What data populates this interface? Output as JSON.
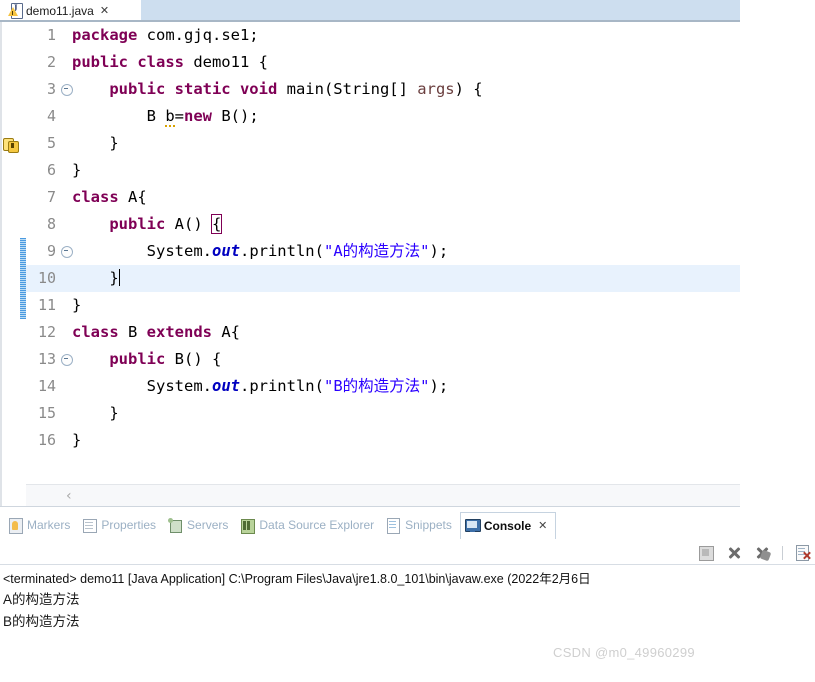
{
  "editor": {
    "tab": {
      "filename": "demo11.java",
      "close_glyph": "✕",
      "icon": "java-file-warning-icon"
    },
    "lines": [
      {
        "num": "1",
        "folding": false,
        "marker": null,
        "current": false,
        "changed": false
      },
      {
        "num": "2",
        "folding": false,
        "marker": null,
        "current": false,
        "changed": false
      },
      {
        "num": "3",
        "folding": true,
        "marker": null,
        "current": false,
        "changed": false
      },
      {
        "num": "4",
        "folding": false,
        "marker": "warning",
        "current": false,
        "changed": false
      },
      {
        "num": "5",
        "folding": false,
        "marker": null,
        "current": false,
        "changed": false
      },
      {
        "num": "6",
        "folding": false,
        "marker": null,
        "current": false,
        "changed": false
      },
      {
        "num": "7",
        "folding": false,
        "marker": null,
        "current": false,
        "changed": false
      },
      {
        "num": "8",
        "folding": true,
        "marker": null,
        "current": false,
        "changed": true
      },
      {
        "num": "9",
        "folding": false,
        "marker": null,
        "current": false,
        "changed": true
      },
      {
        "num": "10",
        "folding": false,
        "marker": null,
        "current": true,
        "changed": true
      },
      {
        "num": "11",
        "folding": false,
        "marker": null,
        "current": false,
        "changed": false
      },
      {
        "num": "12",
        "folding": false,
        "marker": null,
        "current": false,
        "changed": false
      },
      {
        "num": "13",
        "folding": true,
        "marker": null,
        "current": false,
        "changed": false
      },
      {
        "num": "14",
        "folding": false,
        "marker": null,
        "current": false,
        "changed": false
      },
      {
        "num": "15",
        "folding": false,
        "marker": null,
        "current": false,
        "changed": false
      },
      {
        "num": "16",
        "folding": false,
        "marker": null,
        "current": false,
        "changed": false
      }
    ],
    "code_text": [
      "package com.gjq.se1;",
      "public class demo11 {",
      "    public static void main(String[] args) {",
      "        B b=new B();",
      "    }",
      "}",
      "class A{",
      "    public A() {",
      "        System.out.println(\"A的构造方法\");",
      "    }",
      "}",
      "class B extends A{",
      "    public B() {",
      "        System.out.println(\"B的构造方法\");",
      "    }",
      "}"
    ],
    "scroll_left_arrow": "‹",
    "colors": {
      "keyword": "#7f0055",
      "string": "#2a00ff",
      "field": "#0000c0",
      "parameter": "#6a3e3e",
      "line_number": "#8a8a8a",
      "current_line_highlight": "#e8f2fd",
      "changed_bar": "#6cb1e8"
    }
  },
  "bottom_view": {
    "tabs": [
      {
        "label": "Markers",
        "icon": "markers-icon",
        "active": false
      },
      {
        "label": "Properties",
        "icon": "properties-icon",
        "active": false
      },
      {
        "label": "Servers",
        "icon": "servers-icon",
        "active": false
      },
      {
        "label": "Data Source Explorer",
        "icon": "data-source-explorer-icon",
        "active": false
      },
      {
        "label": "Snippets",
        "icon": "snippets-icon",
        "active": false
      },
      {
        "label": "Console",
        "icon": "console-icon",
        "active": true
      }
    ],
    "active_tab_close_glyph": "✕",
    "toolbar": [
      {
        "name": "terminate-button",
        "icon": "stop-square-icon"
      },
      {
        "name": "remove-launch-button",
        "icon": "x-icon"
      },
      {
        "name": "remove-all-terminated-button",
        "icon": "x-tools-icon"
      },
      {
        "name": "clear-console-button",
        "icon": "page-x-icon"
      }
    ],
    "console": {
      "terminated_line": "<terminated> demo11 [Java Application] C:\\Program Files\\Java\\jre1.8.0_101\\bin\\javaw.exe (2022年2月6日 ",
      "output": [
        "A的构造方法",
        "B的构造方法"
      ]
    }
  },
  "watermark": "CSDN @m0_49960299"
}
